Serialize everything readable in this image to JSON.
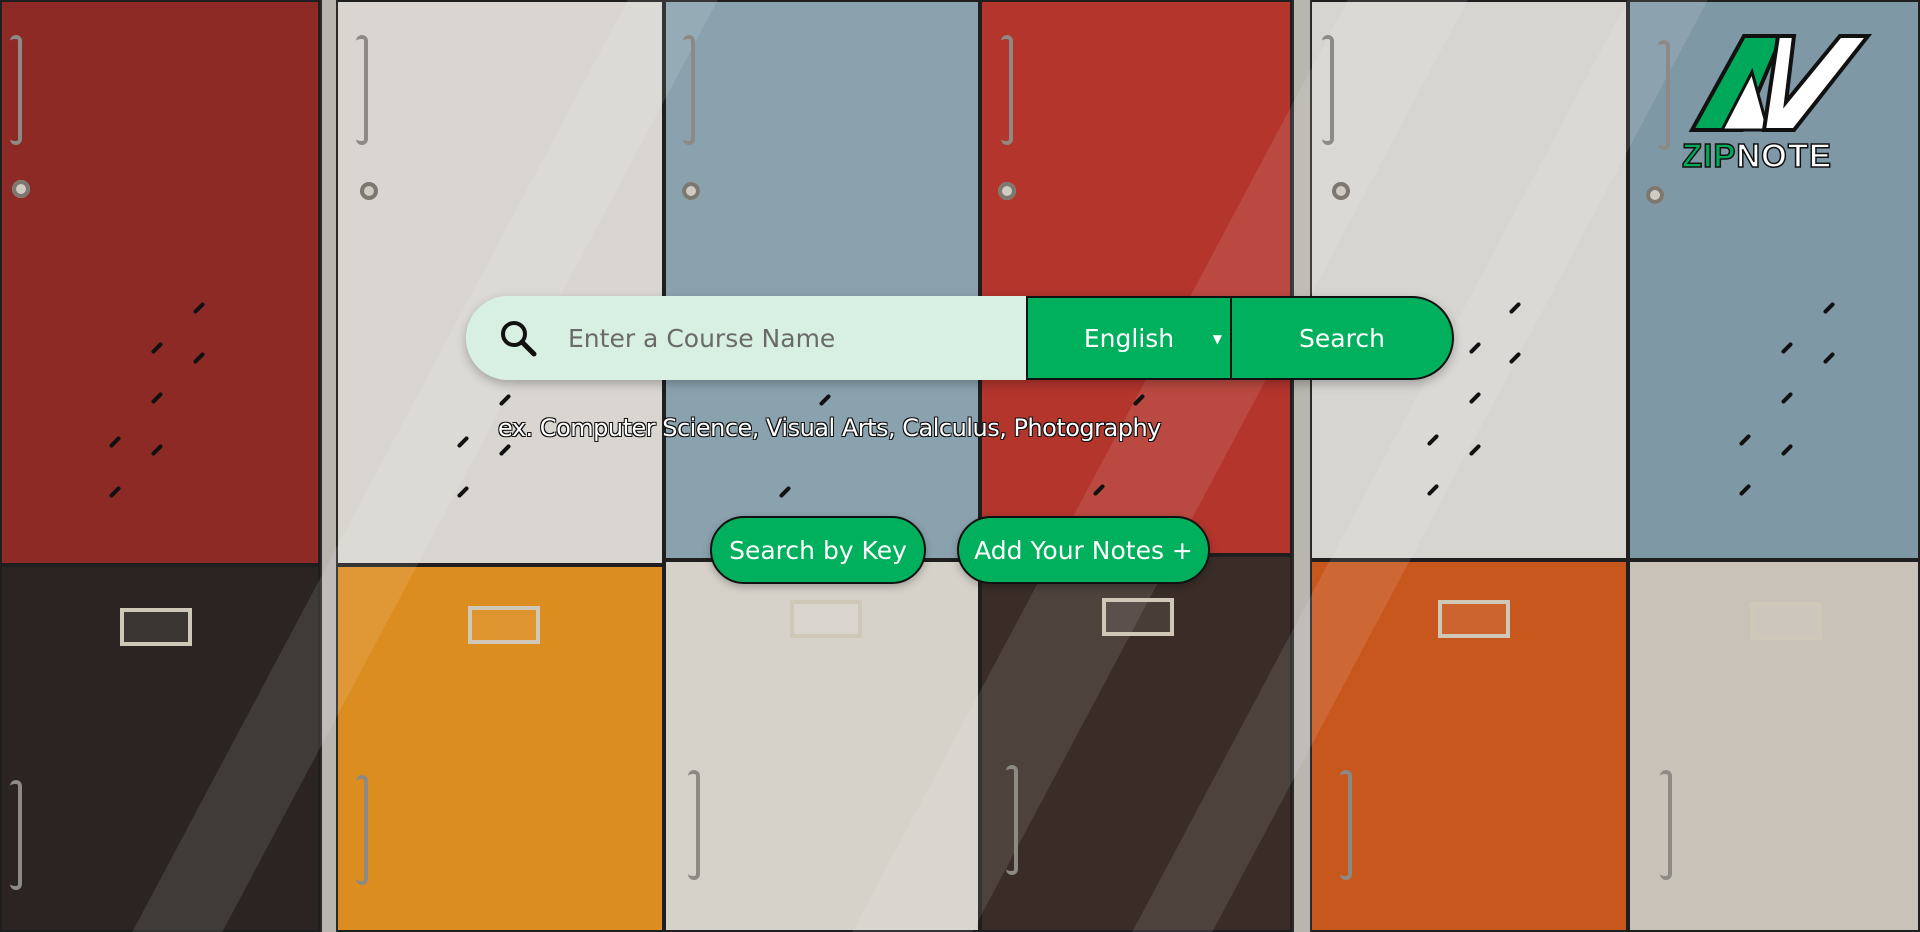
{
  "brand": {
    "name_part1": "ZIP",
    "name_part2": "NOTE",
    "icon": "zipnote-logo-icon"
  },
  "search": {
    "placeholder": "Enter a Course Name",
    "value": "",
    "icon": "search-icon",
    "language_selected": "English",
    "submit_label": "Search"
  },
  "examples_text": "ex. Computer Science, Visual Arts, Calculus, Photography",
  "actions": {
    "search_by_key_label": "Search by Key",
    "add_notes_label": "Add Your Notes +"
  },
  "colors": {
    "accent": "#00b05c",
    "input_bg": "#d8f0e1"
  }
}
